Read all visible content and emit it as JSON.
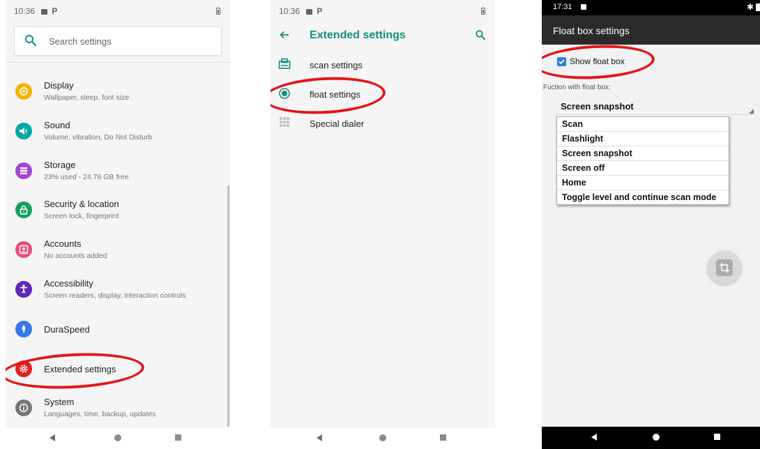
{
  "panel1": {
    "status_time": "10:36",
    "status_p": "P",
    "search_placeholder": "Search settings",
    "items": [
      {
        "title": "Display",
        "subtitle": "Wallpaper, sleep, font size",
        "icon": "brightness-icon",
        "color": "#f4b400"
      },
      {
        "title": "Sound",
        "subtitle": "Volume, vibration, Do Not Disturb",
        "icon": "volume-icon",
        "color": "#00aaa3"
      },
      {
        "title": "Storage",
        "subtitle": "23% used - 24.76 GB free",
        "icon": "storage-icon",
        "color": "#a445d6"
      },
      {
        "title": "Security & location",
        "subtitle": "Screen lock, fingerprint",
        "icon": "lock-icon",
        "color": "#16a05d"
      },
      {
        "title": "Accounts",
        "subtitle": "No accounts added",
        "icon": "account-icon",
        "color": "#ec4c7c"
      },
      {
        "title": "Accessibility",
        "subtitle": "Screen readers, display, interaction controls",
        "icon": "accessibility-icon",
        "color": "#5c2ab8"
      },
      {
        "title": "DuraSpeed",
        "subtitle": "",
        "icon": "rocket-icon",
        "color": "#3b78e7"
      },
      {
        "title": "Extended settings",
        "subtitle": "",
        "icon": "gear-icon",
        "color": "#e0201e"
      },
      {
        "title": "System",
        "subtitle": "Languages, time, backup, updates",
        "icon": "info-icon",
        "color": "#757575"
      }
    ]
  },
  "panel2": {
    "status_time": "10:36",
    "status_p": "P",
    "title": "Extended settings",
    "accent": "#0f8f7f",
    "items": [
      {
        "label": "scan settings",
        "icon": "scanner-icon"
      },
      {
        "label": "float settings",
        "icon": "radio-dot-icon"
      },
      {
        "label": "Special dialer",
        "icon": "dialpad-icon"
      }
    ]
  },
  "panel3": {
    "status_time": "17:31",
    "title": "Float box settings",
    "show_float_label": "Show float box",
    "show_float_checked": true,
    "function_label": "Fuction with float box:",
    "selected_function": "Screen snapshot",
    "options": [
      "Scan",
      "Flashlight",
      "Screen snapshot",
      "Screen off",
      "Home",
      "Toggle level and continue scan mode"
    ]
  }
}
